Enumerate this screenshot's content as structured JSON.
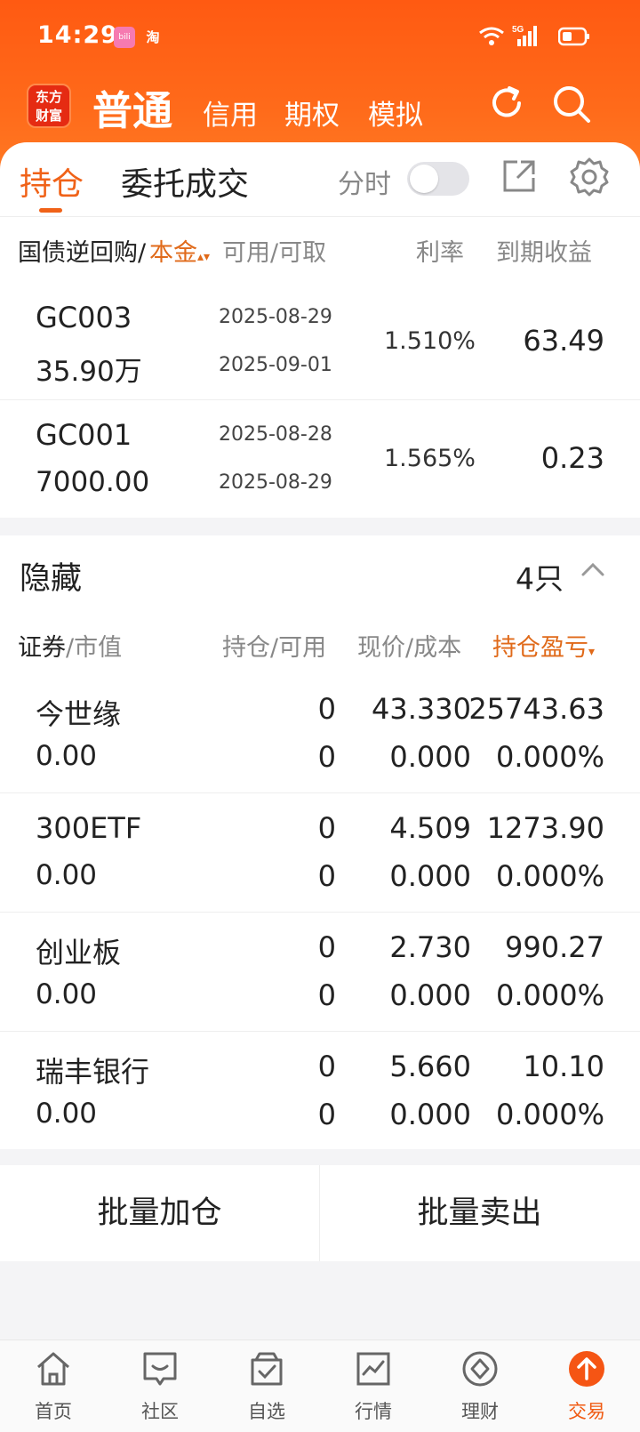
{
  "status_bar": {
    "time": "14:29",
    "app1": "bili",
    "app2": "淘",
    "network": "5G"
  },
  "header": {
    "logo": [
      "东方",
      "财富"
    ],
    "tabs": [
      "普通",
      "信用",
      "期权",
      "模拟"
    ]
  },
  "subtabs": {
    "active": "持仓",
    "second": "委托成交",
    "toggle_label": "分时",
    "toggle_on": false
  },
  "repo_table": {
    "headers": {
      "col1_a": "国债逆回购/",
      "col1_b": "本金",
      "col2": "可用/可取",
      "col3": "利率",
      "col4": "到期收益"
    },
    "rows": [
      {
        "code": "GC003",
        "principal": "35.90万",
        "date1": "2025-08-29",
        "date2": "2025-09-01",
        "rate": "1.510%",
        "income": "63.49"
      },
      {
        "code": "GC001",
        "principal": "7000.00",
        "date1": "2025-08-28",
        "date2": "2025-08-29",
        "rate": "1.565%",
        "income": "0.23"
      }
    ]
  },
  "hidden_section": {
    "title": "隐藏",
    "count": "4只"
  },
  "stock_table": {
    "headers": {
      "col1_a": "证券",
      "col1_b": "/市值",
      "col2": "持仓/可用",
      "col3": "现价/成本",
      "col4": "持仓盈亏"
    },
    "rows": [
      {
        "name": "今世缘",
        "value": "0.00",
        "hold": "0",
        "avail": "0",
        "price": "43.330",
        "cost": "0.000",
        "pnl": "25743.63",
        "pnl_pct": "0.000%"
      },
      {
        "name": "300ETF",
        "value": "0.00",
        "hold": "0",
        "avail": "0",
        "price": "4.509",
        "cost": "0.000",
        "pnl": "1273.90",
        "pnl_pct": "0.000%"
      },
      {
        "name": "创业板",
        "value": "0.00",
        "hold": "0",
        "avail": "0",
        "price": "2.730",
        "cost": "0.000",
        "pnl": "990.27",
        "pnl_pct": "0.000%"
      },
      {
        "name": "瑞丰银行",
        "value": "0.00",
        "hold": "0",
        "avail": "0",
        "price": "5.660",
        "cost": "0.000",
        "pnl": "10.10",
        "pnl_pct": "0.000%"
      }
    ]
  },
  "batch": {
    "add": "批量加仓",
    "sell": "批量卖出"
  },
  "bottom_nav": [
    "首页",
    "社区",
    "自选",
    "行情",
    "理财",
    "交易"
  ],
  "colors": {
    "brand": "#ff5a12",
    "accent": "#f06218",
    "loss_red": "#d8333a"
  }
}
